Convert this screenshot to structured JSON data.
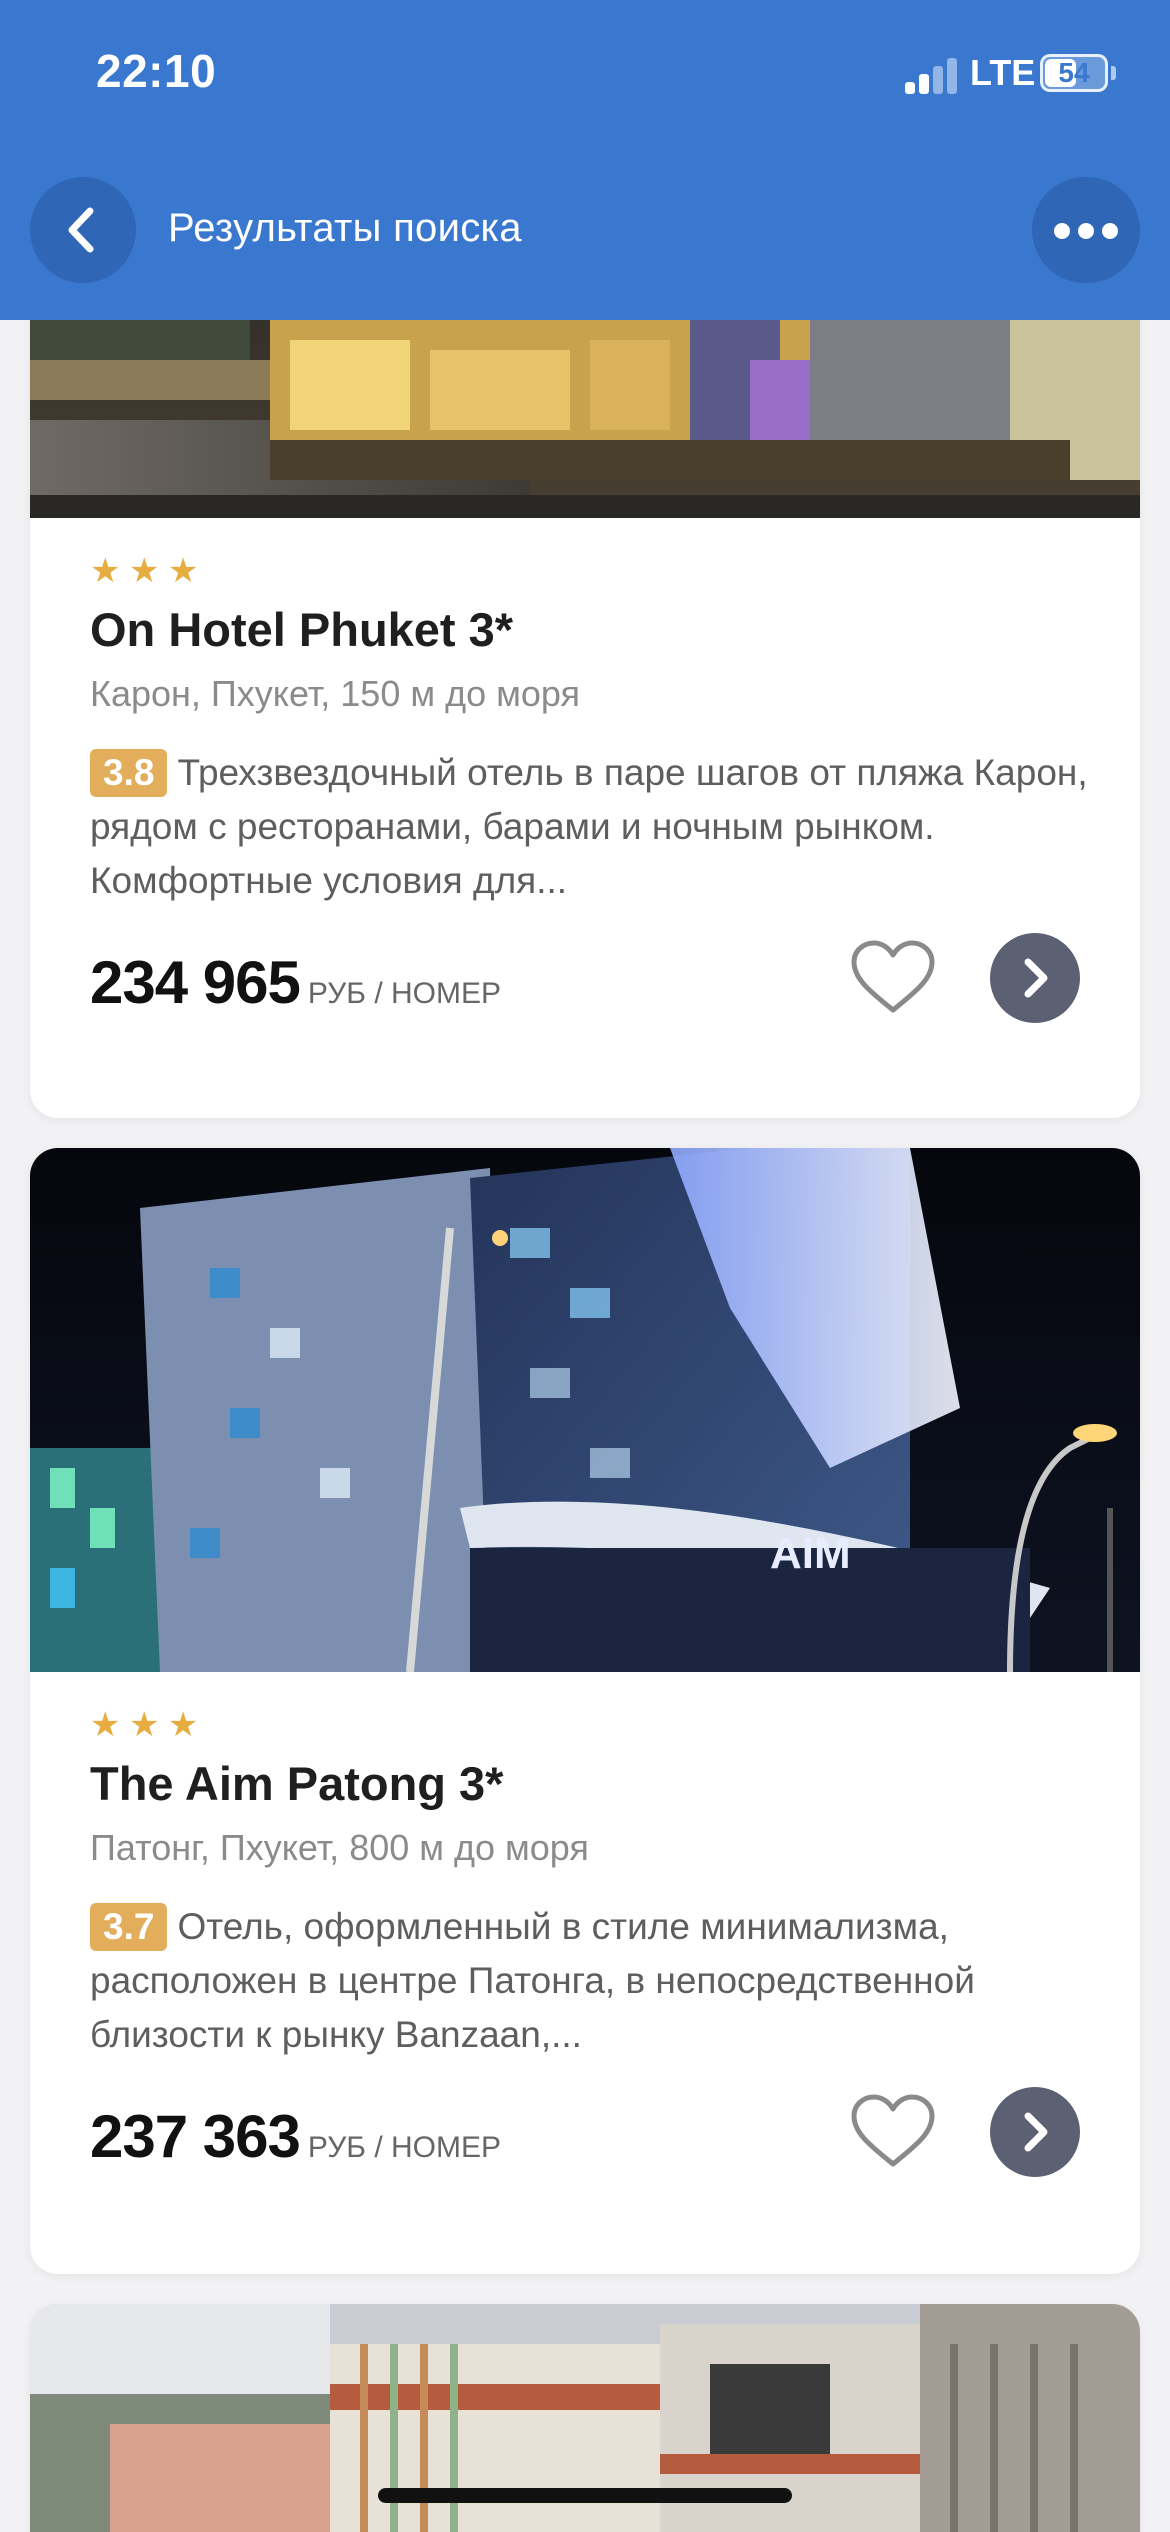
{
  "status_bar": {
    "time": "22:10",
    "network": "LTE",
    "battery": "54",
    "battery_level": 0.54
  },
  "nav": {
    "title": "Результаты поиска"
  },
  "hotels": [
    {
      "stars": [
        "★",
        "★",
        "★"
      ],
      "name": "On Hotel Phuket 3*",
      "location": "Карон, Пхукет, 150 м до моря",
      "rating": "3.8",
      "description": "Трехзвездочный отель в паре шагов от пляжа Карон, рядом с ресторанами, барами и ночным рынком. Комфортные условия для...",
      "price": "234 965",
      "price_unit": "РУБ / НОМЕР"
    },
    {
      "stars": [
        "★",
        "★",
        "★"
      ],
      "name": "The Aim Patong 3*",
      "location": "Патонг, Пхукет, 800 м до моря",
      "rating": "3.7",
      "description": "Отель, оформленный в стиле минимализма, расположен в центре Патонга, в непосредственной близости к рынку Banzaan,...",
      "price": "237 363",
      "price_unit": "РУБ / НОМЕР"
    }
  ],
  "image_sign": "AIM"
}
